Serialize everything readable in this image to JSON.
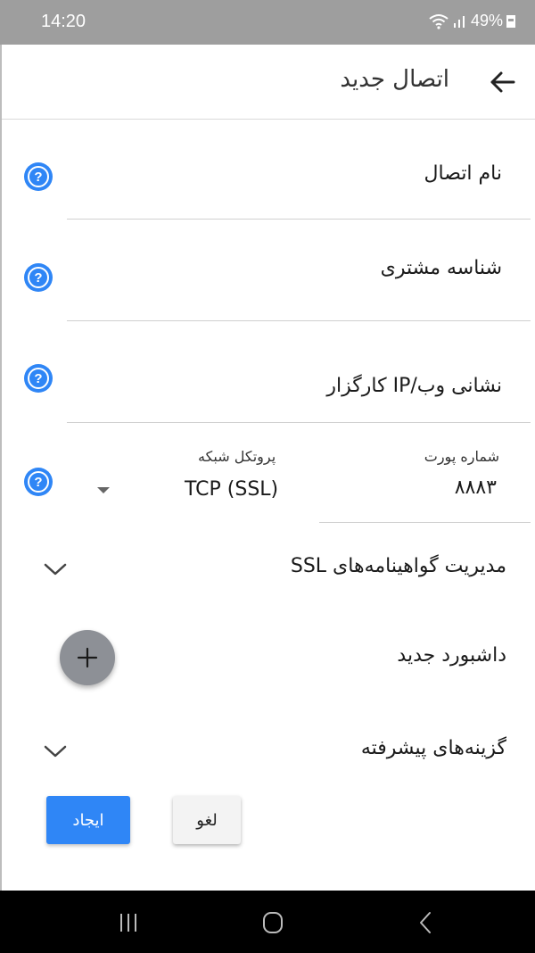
{
  "status_bar": {
    "time": "14:20",
    "battery_percent": "49%"
  },
  "app_bar": {
    "title": "اتصال جدید"
  },
  "fields": {
    "connection_name": {
      "label": "نام اتصال"
    },
    "client_id": {
      "label": "شناسه مشتری"
    },
    "server_address": {
      "label": "نشانی وب/IP کارگزار"
    },
    "port": {
      "label": "شماره پورت",
      "value": "۸۸۸۳"
    },
    "protocol": {
      "label": "پروتکل شبکه",
      "value": "TCP (SSL)"
    }
  },
  "sections": {
    "ssl_certificates": {
      "label": "مدیریت گواهینامه‌های SSL"
    },
    "new_dashboard": {
      "label": "داشبورد جدید"
    },
    "advanced_options": {
      "label": "گزینه‌های پیشرفته"
    }
  },
  "buttons": {
    "create_label": "ایجاد",
    "cancel_label": "لغو"
  },
  "colors": {
    "accent": "#2f86f6",
    "status_bar": "#9e9e9e",
    "fab": "#8d9096",
    "nav_bar": "#000000"
  },
  "icons": [
    "back-arrow-icon",
    "help-icon",
    "chevron-down-icon",
    "plus-icon",
    "wifi-icon",
    "signal-icon",
    "battery-icon",
    "nav-recents-icon",
    "nav-home-icon",
    "nav-back-icon"
  ]
}
